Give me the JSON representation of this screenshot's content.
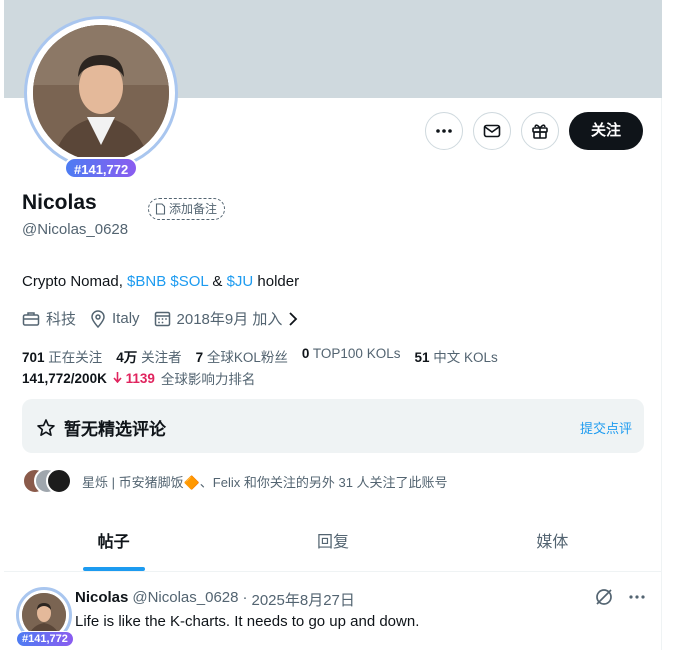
{
  "profile": {
    "name": "Nicolas",
    "handle": "@Nicolas_0628",
    "rank_badge": "#141,772",
    "add_note_label": "添加备注",
    "follow_label": "关注",
    "bio": {
      "prefix": "Crypto Nomad, ",
      "tag1": "$BNB",
      "space": " ",
      "tag2": "$SOL",
      "amp": " & ",
      "tag3": "$JU",
      "suffix": " holder"
    },
    "meta": {
      "category": "科技",
      "location": "Italy",
      "joined": "2018年9月 加入"
    }
  },
  "stats": {
    "following_count": "701",
    "following_label": "正在关注",
    "followers_count": "4万",
    "followers_label": "关注者",
    "kol_followers_count": "7",
    "kol_followers_label": "全球KOL粉丝",
    "top100_count": "0",
    "top100_label": "TOP100 KOLs",
    "cn_kols_count": "51",
    "cn_kols_label": "中文 KOLs",
    "rank_value": "141,772/200K",
    "rank_change": "1139",
    "rank_label": "全球影响力排名"
  },
  "featured": {
    "title": "暂无精选评论",
    "link": "提交点评"
  },
  "followed_by": {
    "text": "星烁 | 币安猪脚饭🔶、Felix 和你关注的另外 31 人关注了此账号"
  },
  "tabs": [
    {
      "label": "帖子"
    },
    {
      "label": "回复"
    },
    {
      "label": "媒体"
    }
  ],
  "post": {
    "name": "Nicolas",
    "handle": "@Nicolas_0628",
    "separator": "·",
    "date": "2025年8月27日",
    "text": "Life is like the K-charts. It needs to go up and down.",
    "rank_badge": "#141,772"
  },
  "colors": {
    "accent": "#1d9bf0",
    "banner": "#cfd9de",
    "rank_down": "#e0245e",
    "follow_button": "#0f1419"
  },
  "icons": {
    "more": "more-icon",
    "mail": "mail-icon",
    "gift": "gift-icon",
    "note": "note-icon",
    "briefcase": "briefcase-icon",
    "location": "location-pin-icon",
    "calendar": "calendar-icon",
    "chevron": "chevron-right-icon",
    "star": "star-icon",
    "arrow_down": "arrow-down-icon",
    "grok": "grok-icon"
  }
}
